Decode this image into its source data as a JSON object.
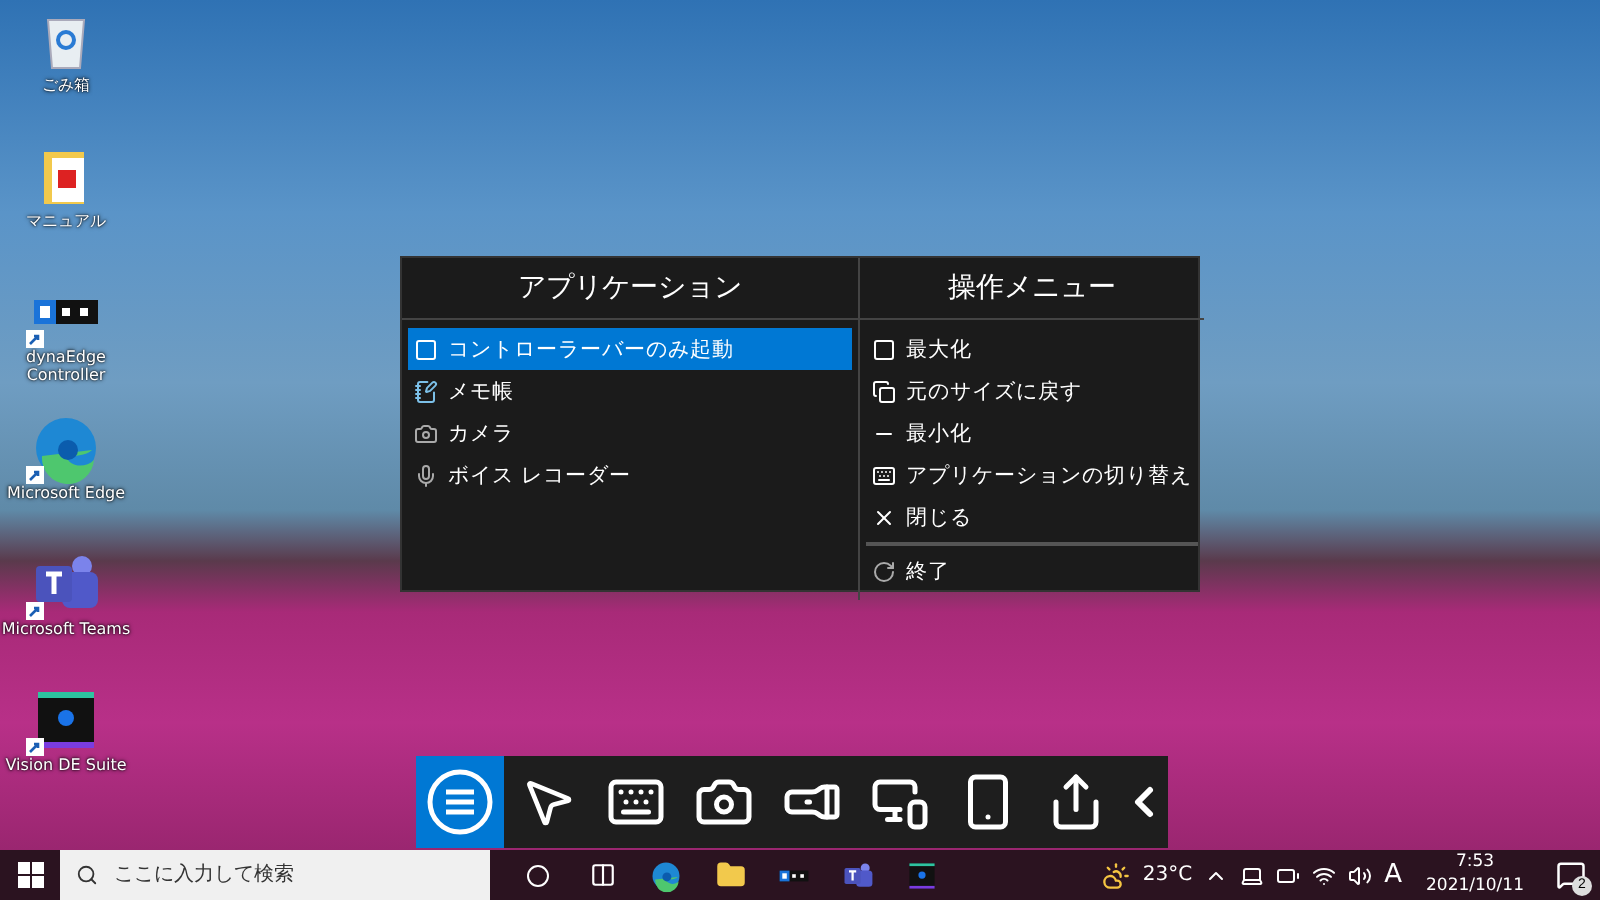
{
  "desktop_icons": [
    {
      "label": "ごみ箱",
      "kind": "recycle"
    },
    {
      "label": "マニュアル",
      "kind": "folder"
    },
    {
      "label": "dynaEdge Controller",
      "kind": "controller",
      "shortcut": true
    },
    {
      "label": "Microsoft Edge",
      "kind": "edge",
      "shortcut": true
    },
    {
      "label": "Microsoft Teams",
      "kind": "teams",
      "shortcut": true
    },
    {
      "label": "Vision DE Suite",
      "kind": "vision",
      "shortcut": true
    }
  ],
  "menu": {
    "applications": {
      "title": "アプリケーション",
      "items": [
        {
          "label": "コントローラーバーのみ起動",
          "kind": "square",
          "selected": true
        },
        {
          "label": "メモ帳",
          "kind": "notepad",
          "selected": false
        },
        {
          "label": "カメラ",
          "kind": "camera",
          "selected": false
        },
        {
          "label": "ボイス レコーダー",
          "kind": "mic",
          "selected": false
        }
      ]
    },
    "operations": {
      "title": "操作メニュー",
      "items": [
        {
          "label": "最大化",
          "kind": "maximize"
        },
        {
          "label": "元のサイズに戻す",
          "kind": "restore"
        },
        {
          "label": "最小化",
          "kind": "minimize"
        },
        {
          "label": "アプリケーションの切り替え",
          "kind": "switch"
        },
        {
          "label": "閉じる",
          "kind": "close"
        },
        {
          "label": "終了",
          "kind": "exit",
          "separated": true
        }
      ]
    }
  },
  "toolbar": [
    {
      "kind": "menu",
      "selected": true
    },
    {
      "kind": "pointer",
      "selected": false
    },
    {
      "kind": "keyboard",
      "selected": false
    },
    {
      "kind": "camera",
      "selected": false
    },
    {
      "kind": "flashlight",
      "selected": false
    },
    {
      "kind": "display",
      "selected": false
    },
    {
      "kind": "remote",
      "selected": false
    },
    {
      "kind": "share",
      "selected": false
    },
    {
      "kind": "collapse",
      "selected": false
    }
  ],
  "taskbar": {
    "search": {
      "placeholder": "ここに入力して検索"
    },
    "apps": [
      {
        "kind": "cortana"
      },
      {
        "kind": "taskview"
      },
      {
        "kind": "edge"
      },
      {
        "kind": "explorer"
      },
      {
        "kind": "controller"
      },
      {
        "kind": "teams"
      },
      {
        "kind": "vision"
      }
    ],
    "weather": "23°C",
    "ime": "A",
    "time": "7:53",
    "date": "2021/10/11",
    "notifications": "2"
  }
}
